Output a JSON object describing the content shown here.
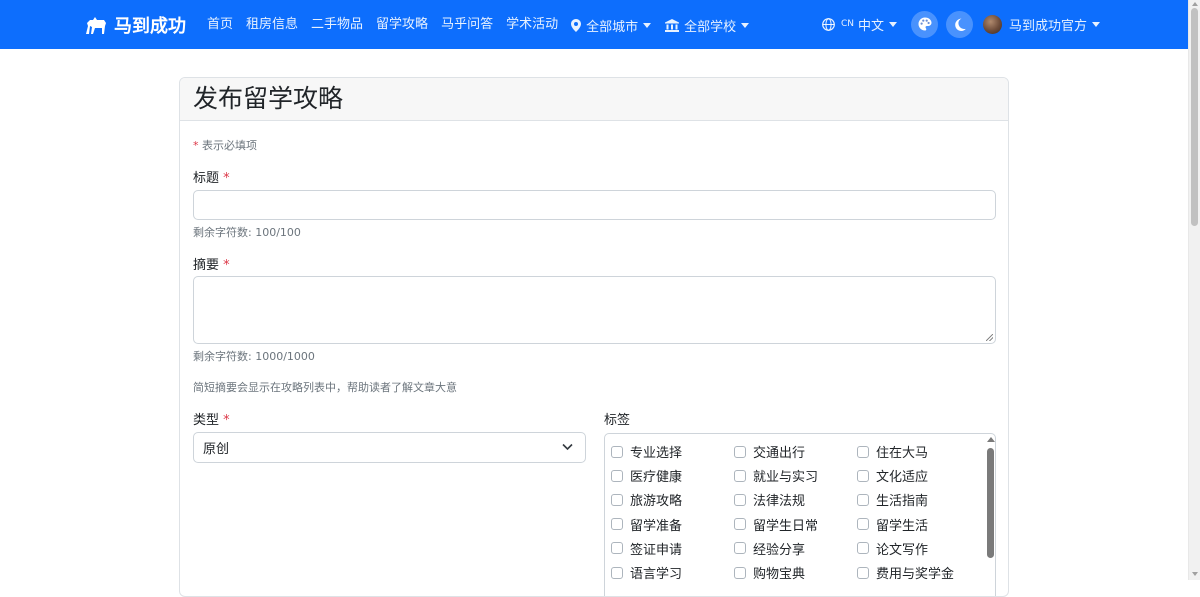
{
  "navbar": {
    "brand": "马到成功",
    "links": [
      "首页",
      "租房信息",
      "二手物品",
      "留学攻略",
      "马乎问答",
      "学术活动"
    ],
    "city_dropdown": "全部城市",
    "school_dropdown": "全部学校",
    "lang_code": "CN",
    "lang_label": "中文",
    "user_name": "马到成功官方",
    "bg_color": "#0d6efd"
  },
  "form": {
    "page_title": "发布留学攻略",
    "required_note_star": "*",
    "required_note": "表示必填项",
    "title_label": "标题",
    "title_value": "",
    "title_counter": "剩余字符数: 100/100",
    "summary_label": "摘要",
    "summary_value": "",
    "summary_counter": "剩余字符数: 1000/1000",
    "summary_help": "简短摘要会显示在攻略列表中，帮助读者了解文章大意",
    "type_label": "类型",
    "type_selected": "原创",
    "tags_label": "标签",
    "tags": [
      "专业选择",
      "交通出行",
      "住在大马",
      "医疗健康",
      "就业与实习",
      "文化适应",
      "旅游攻略",
      "法律法规",
      "生活指南",
      "留学准备",
      "留学生日常",
      "留学生活",
      "签证申请",
      "经验分享",
      "论文写作",
      "语言学习",
      "购物宝典",
      "费用与奖学金"
    ]
  }
}
